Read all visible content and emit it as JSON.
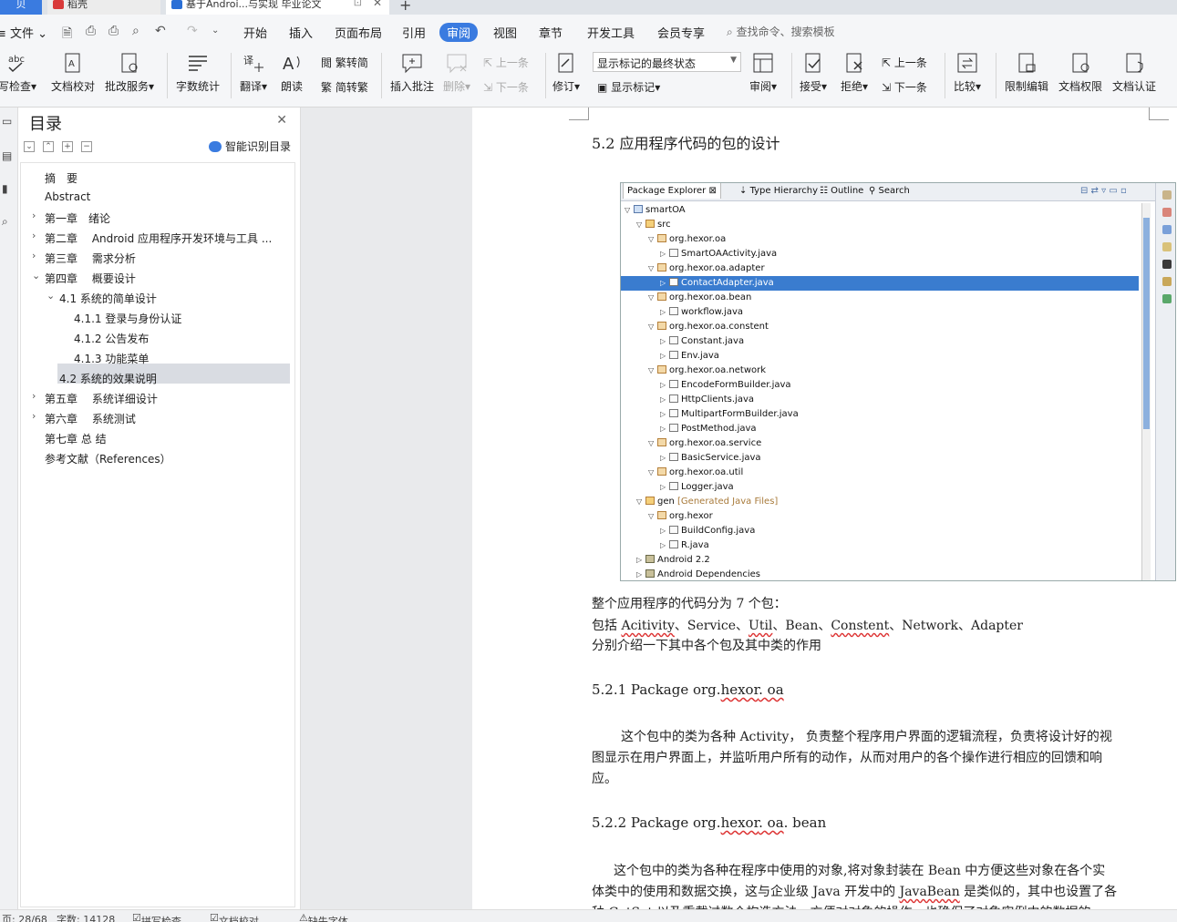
{
  "tabs": [
    {
      "label": "贝"
    },
    {
      "label": "稻壳"
    },
    {
      "label": "基于Androi...与实现 毕业论文"
    }
  ],
  "menubar": {
    "file": "文件",
    "items": [
      "开始",
      "插入",
      "页面布局",
      "引用",
      "审阅",
      "视图",
      "章节",
      "开发工具",
      "会员专享"
    ],
    "active": "审阅",
    "search_placeholder": "查找命令、搜索模板"
  },
  "ribbon": {
    "spellcheck": "写检查",
    "doc_proof": "文档校对",
    "batch_service": "批改服务",
    "word_count": "字数统计",
    "translate": "翻译",
    "read_aloud": "朗读",
    "trad_to_simp": "繁转简",
    "simp_to_trad": "简转繁",
    "insert_comment": "插入批注",
    "delete": "删除",
    "prev": "上一条",
    "next": "下一条",
    "revise": "修订",
    "markup_mode": "显示标记的最终状态",
    "show_markup": "显示标记",
    "review": "审阅",
    "accept": "接受",
    "reject": "拒绝",
    "prev2": "上一条",
    "next2": "下一条",
    "compare": "比较",
    "restrict_edit": "限制编辑",
    "doc_rights": "文档权限",
    "doc_auth": "文档认证"
  },
  "toc": {
    "title": "目录",
    "smart": "智能识别目录",
    "items": [
      {
        "label": "摘　要",
        "arrow": ""
      },
      {
        "label": "Abstract",
        "arrow": ""
      },
      {
        "label": "第一章　绪论",
        "arrow": "›"
      },
      {
        "label": "第二章　 Android 应用程序开发环境与工具 ...",
        "arrow": "›"
      },
      {
        "label": "第三章　 需求分析",
        "arrow": "›"
      },
      {
        "label": "第四章　 概要设计",
        "arrow": "⌄"
      },
      {
        "label": "4.1  系统的简单设计",
        "arrow": "⌄"
      },
      {
        "label": "4.1.1  登录与身份认证",
        "arrow": ""
      },
      {
        "label": "4.1.2  公告发布",
        "arrow": ""
      },
      {
        "label": "4.1.3  功能菜单",
        "arrow": ""
      },
      {
        "label": "4.2 系统的效果说明",
        "arrow": ""
      },
      {
        "label": "第五章　 系统详细设计",
        "arrow": "›"
      },
      {
        "label": "第六章　 系统测试",
        "arrow": "›"
      },
      {
        "label": "第七章 总 结",
        "arrow": ""
      },
      {
        "label": "参考文献（References）",
        "arrow": ""
      }
    ]
  },
  "doc": {
    "heading": "5.2  应用程序代码的包的设计",
    "p1": "整个应用程序的代码分为 7 个包：",
    "p2_prefix": "包括 ",
    "p2_items": [
      "Acitivity",
      "Service",
      "Util",
      "Bean",
      "Constent",
      "Network",
      "Adapter"
    ],
    "p3": "分别介绍一下其中各个包及其中类的作用",
    "h521_prefix": "5.2.1  Package  org.",
    "h521_mid": "hexor",
    "h521_suffix": ". oa",
    "para521_l1": "这个包中的类为各种 Activity， 负责整个程序用户界面的逻辑流程，负责将设计好的视",
    "para521_l2": "图显示在用户界面上，并监听用户所有的动作，从而对用户的各个操作进行相应的回馈和响",
    "para521_l3": "应。",
    "h522_prefix": "5.2.2  Package  org.",
    "h522_mid": "hexor",
    "h522_mid2": ". oa",
    "h522_suffix": ". bean",
    "para522_l1": "这个包中的类为各种在程序中使用的对象,将对象封装在 Bean 中方便这些对象在各个实",
    "para522_l2a": "体类中的使用和数据交换，这与企业级 Java 开发中的 ",
    "para522_l2b": "JavaBean",
    "para522_l2c": " 是类似的，其中也设置了各",
    "para522_l3": "种 GetSet 以及重载过数个构造方法，方便对对象的操作，也确保了对象实例中的数据的"
  },
  "eclipse": {
    "tabs": [
      "Package Explorer",
      "Type Hierarchy",
      "Outline",
      "Search"
    ],
    "tree": [
      {
        "label": "smartOA",
        "indent": 0,
        "tw": "▽",
        "icon": "proj"
      },
      {
        "label": "src",
        "indent": 1,
        "tw": "▽",
        "icon": "src"
      },
      {
        "label": "org.hexor.oa",
        "indent": 2,
        "tw": "▽",
        "icon": "pkg"
      },
      {
        "label": "SmartOAActivity.java",
        "indent": 3,
        "tw": "▷",
        "icon": "java"
      },
      {
        "label": "org.hexor.oa.adapter",
        "indent": 2,
        "tw": "▽",
        "icon": "pkg"
      },
      {
        "label": "ContactAdapter.java",
        "indent": 3,
        "tw": "▷",
        "icon": "java",
        "selected": true
      },
      {
        "label": "org.hexor.oa.bean",
        "indent": 2,
        "tw": "▽",
        "icon": "pkg"
      },
      {
        "label": "workflow.java",
        "indent": 3,
        "tw": "▷",
        "icon": "java"
      },
      {
        "label": "org.hexor.oa.constent",
        "indent": 2,
        "tw": "▽",
        "icon": "pkg"
      },
      {
        "label": "Constant.java",
        "indent": 3,
        "tw": "▷",
        "icon": "java"
      },
      {
        "label": "Env.java",
        "indent": 3,
        "tw": "▷",
        "icon": "java"
      },
      {
        "label": "org.hexor.oa.network",
        "indent": 2,
        "tw": "▽",
        "icon": "pkg"
      },
      {
        "label": "EncodeFormBuilder.java",
        "indent": 3,
        "tw": "▷",
        "icon": "java"
      },
      {
        "label": "HttpClients.java",
        "indent": 3,
        "tw": "▷",
        "icon": "java"
      },
      {
        "label": "MultipartFormBuilder.java",
        "indent": 3,
        "tw": "▷",
        "icon": "java"
      },
      {
        "label": "PostMethod.java",
        "indent": 3,
        "tw": "▷",
        "icon": "java"
      },
      {
        "label": "org.hexor.oa.service",
        "indent": 2,
        "tw": "▽",
        "icon": "pkg"
      },
      {
        "label": "BasicService.java",
        "indent": 3,
        "tw": "▷",
        "icon": "java"
      },
      {
        "label": "org.hexor.oa.util",
        "indent": 2,
        "tw": "▽",
        "icon": "pkg"
      },
      {
        "label": "Logger.java",
        "indent": 3,
        "tw": "▷",
        "icon": "java"
      },
      {
        "label": "gen",
        "indent": 1,
        "tw": "▽",
        "icon": "src",
        "note": "[Generated Java Files]"
      },
      {
        "label": "org.hexor",
        "indent": 2,
        "tw": "▽",
        "icon": "pkg"
      },
      {
        "label": "BuildConfig.java",
        "indent": 3,
        "tw": "▷",
        "icon": "java"
      },
      {
        "label": "R.java",
        "indent": 3,
        "tw": "▷",
        "icon": "java"
      },
      {
        "label": "Android 2.2",
        "indent": 1,
        "tw": "▷",
        "icon": "lib"
      },
      {
        "label": "Android Dependencies",
        "indent": 1,
        "tw": "▷",
        "icon": "lib"
      }
    ]
  },
  "status": {
    "page": "页: 28/68",
    "words": "字数: 14128",
    "spell": "拼写检查",
    "proof": "文档校对",
    "missing_font": "缺失字体"
  },
  "colors": {
    "accent": "#3a7be0",
    "selection": "#3a7ccf"
  }
}
